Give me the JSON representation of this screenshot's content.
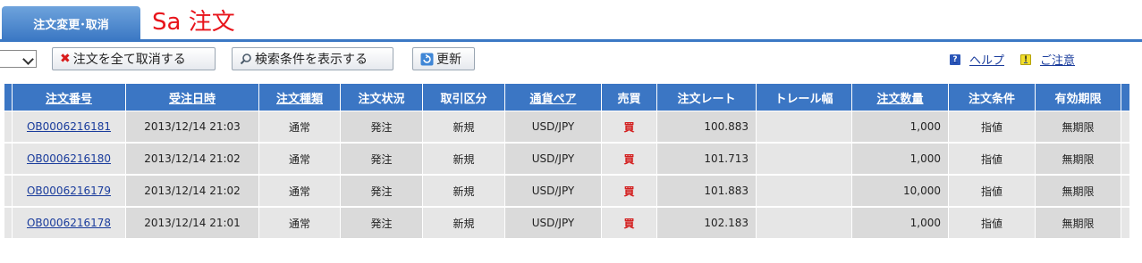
{
  "tab": {
    "label": "注文変更･取消"
  },
  "page_title": "Sa 注文",
  "toolbar": {
    "select_value": "ﾆ",
    "cancel_all_label": "注文を全て取消する",
    "show_search_label": "検索条件を表示する",
    "refresh_label": "更新",
    "help_label": "ヘルプ",
    "notice_label": "ご注意"
  },
  "table": {
    "columns": [
      "注文番号",
      "受注日時",
      "注文種類",
      "注文状況",
      "取引区分",
      "通貨ペア",
      "売買",
      "注文レート",
      "トレール幅",
      "注文数量",
      "注文条件",
      "有効期限"
    ],
    "rows": [
      {
        "order_no": "OB0006216181",
        "date": "2013/12/14 21:03",
        "type": "通常",
        "status": "発注",
        "trade_class": "新規",
        "pair": "USD/JPY",
        "side": "買",
        "rate": "100.883",
        "trail": "",
        "qty": "1,000",
        "condition": "指値",
        "expiry": "無期限"
      },
      {
        "order_no": "OB0006216180",
        "date": "2013/12/14 21:02",
        "type": "通常",
        "status": "発注",
        "trade_class": "新規",
        "pair": "USD/JPY",
        "side": "買",
        "rate": "101.713",
        "trail": "",
        "qty": "1,000",
        "condition": "指値",
        "expiry": "無期限"
      },
      {
        "order_no": "OB0006216179",
        "date": "2013/12/14 21:02",
        "type": "通常",
        "status": "発注",
        "trade_class": "新規",
        "pair": "USD/JPY",
        "side": "買",
        "rate": "101.883",
        "trail": "",
        "qty": "10,000",
        "condition": "指値",
        "expiry": "無期限"
      },
      {
        "order_no": "OB0006216178",
        "date": "2013/12/14 21:01",
        "type": "通常",
        "status": "発注",
        "trade_class": "新規",
        "pair": "USD/JPY",
        "side": "買",
        "rate": "102.183",
        "trail": "",
        "qty": "1,000",
        "condition": "指値",
        "expiry": "無期限"
      }
    ]
  }
}
